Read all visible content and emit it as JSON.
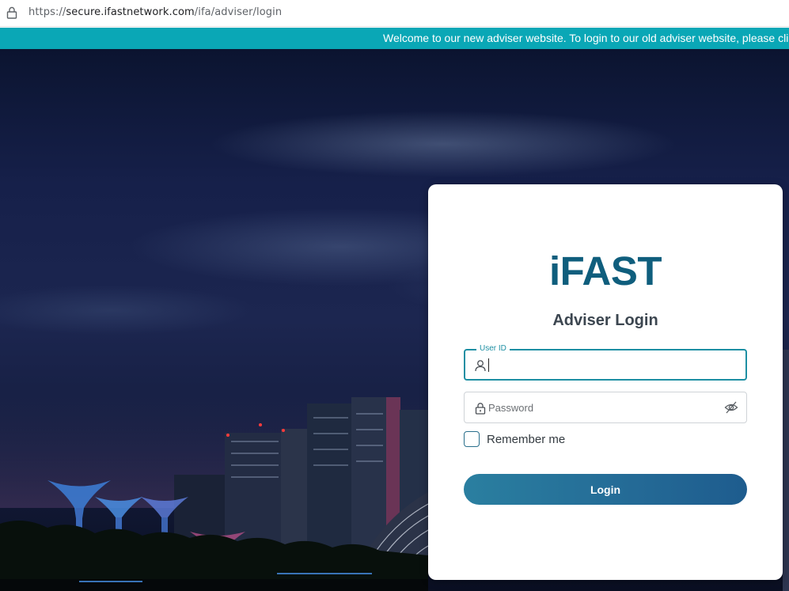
{
  "browser": {
    "url_scheme": "https://",
    "url_host": "secure.ifastnetwork.com",
    "url_path": "/ifa/adviser/login",
    "lock_icon": "lock-icon"
  },
  "banner": {
    "text": "Welcome to our new adviser website. To login to our old adviser website, please cli",
    "color": "#0aa7b6"
  },
  "login": {
    "logo": "iFAST",
    "title": "Adviser Login",
    "user_id": {
      "label": "User ID",
      "value": "",
      "icon": "user-icon"
    },
    "password": {
      "placeholder": "Password",
      "icon": "lock-icon",
      "toggle_icon": "eye-off-icon"
    },
    "remember_label": "Remember me",
    "remember_checked": false,
    "button_label": "Login",
    "brand_color": "#0f5e7d",
    "accent_color": "#1d8fa3"
  }
}
